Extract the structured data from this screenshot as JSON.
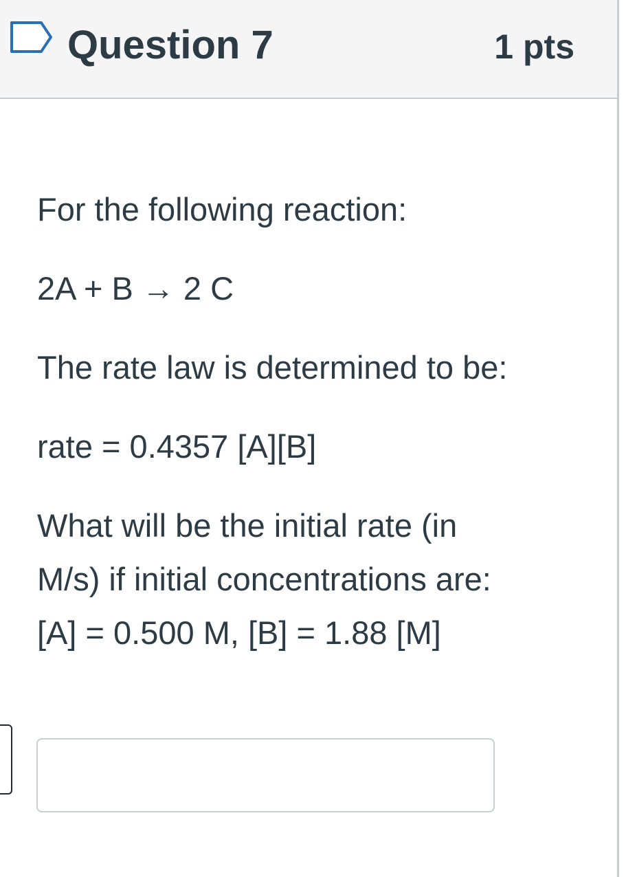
{
  "question": {
    "title": "Question 7",
    "points": "1 pts",
    "flag_icon": "flag-outline-icon",
    "lines": [
      "For the following reaction:",
      "2A + B → 2 C",
      "The rate law is determined to be:",
      "rate = 0.4357 [A][B]",
      "What will be the initial rate (in",
      "M/s) if initial concentrations are:",
      "[A] = 0.500 M, [B] = 1.88 [M]"
    ],
    "answer": {
      "value": "",
      "placeholder": ""
    }
  },
  "colors": {
    "header_bg": "#f5f5f5",
    "text": "#2d3b45",
    "border": "#c7cdd1",
    "flag_stroke": "#2b6fb3"
  }
}
